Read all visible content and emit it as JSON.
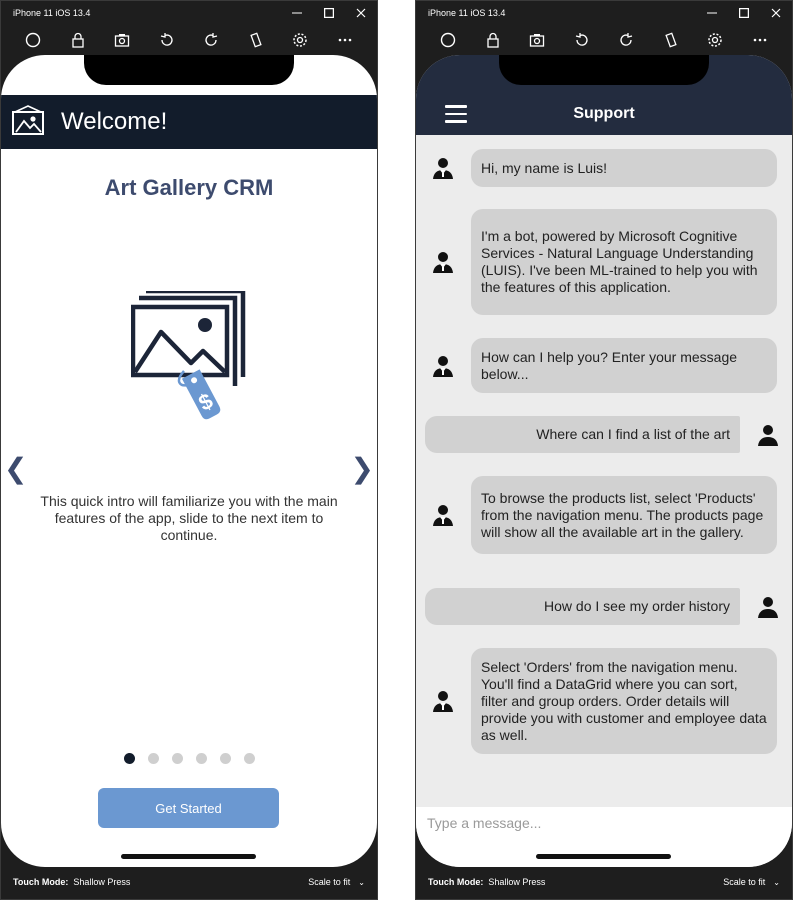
{
  "left_sim": {
    "window_title": "iPhone 11 iOS 13.4",
    "status": {
      "touch_mode_label": "Touch Mode:",
      "touch_mode_value": "Shallow Press",
      "scale": "Scale to fit"
    },
    "app": {
      "header_title": "Welcome!",
      "app_title": "Art Gallery CRM",
      "intro_text": "This quick intro will familiarize you with the main features of the app, slide to the next item to continue.",
      "prev_arrow": "❮",
      "next_arrow": "❯",
      "page_count": 6,
      "current_page": 1,
      "button_label": "Get Started",
      "colors": {
        "header_bg": "#121c2b",
        "title": "#3d4b6e",
        "button": "#6b98d1",
        "tag": "#6b98d1"
      }
    }
  },
  "right_sim": {
    "window_title": "iPhone 11 iOS 13.4",
    "status": {
      "touch_mode_label": "Touch Mode:",
      "touch_mode_value": "Shallow Press",
      "scale": "Scale to fit"
    },
    "app": {
      "header_title": "Support",
      "messages": [
        {
          "from": "bot",
          "text": "Hi, my name is Luis!"
        },
        {
          "from": "bot",
          "text": "I'm a bot, powered by Microsoft Cognitive Services - Natural Language Understanding (LUIS). I've been ML-trained to help you with the features of this application."
        },
        {
          "from": "bot",
          "text": "How can I help you? Enter your message below..."
        },
        {
          "from": "user",
          "text": "Where can I find a list of the art"
        },
        {
          "from": "bot",
          "text": "To browse the products list, select 'Products' from the navigation menu. The products page will show all the available art in the gallery."
        },
        {
          "from": "user",
          "text": "How do I see my order history"
        },
        {
          "from": "bot",
          "text": "Select 'Orders' from the navigation menu. You'll find a DataGrid where you can sort, filter and group orders. Order details will provide you with customer and employee data as well."
        }
      ],
      "composer": {
        "placeholder": "Type a message...",
        "value": ""
      },
      "colors": {
        "header_bg": "#232c3f",
        "bubble": "#d1d1d1",
        "chat_bg": "#ececec"
      }
    }
  },
  "toolbar_icons": [
    "home-icon",
    "lock-icon",
    "screenshot-icon",
    "rotate-left-icon",
    "rotate-right-icon",
    "shake-icon",
    "settings-icon",
    "more-icon"
  ]
}
